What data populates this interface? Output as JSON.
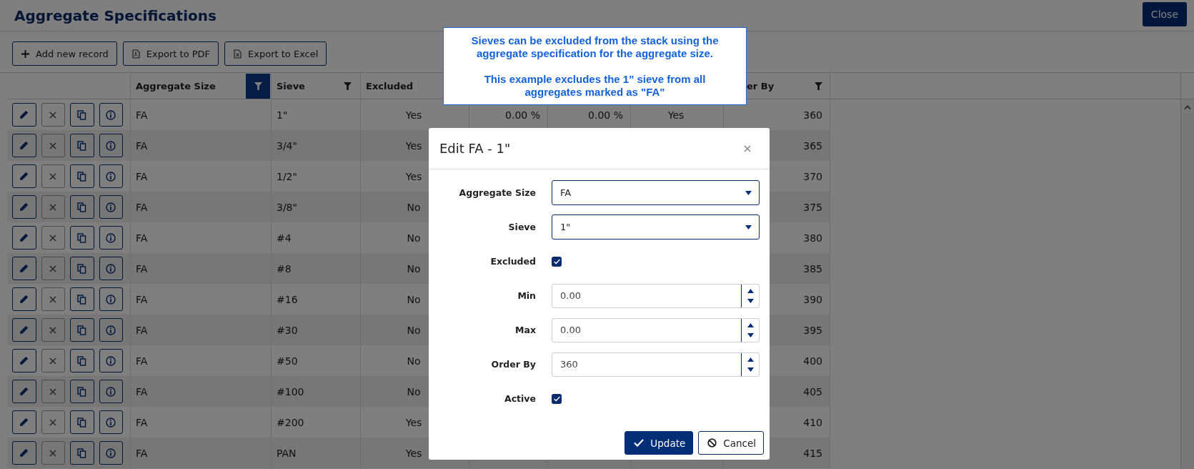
{
  "page": {
    "title": "Aggregate Specifications",
    "close_button": "Close"
  },
  "toolbar": [
    {
      "kind": "add",
      "label": "Add new record"
    },
    {
      "kind": "pdf",
      "label": "Export to PDF"
    },
    {
      "kind": "excel",
      "label": "Export to Excel"
    }
  ],
  "table": {
    "columns": [
      {
        "label": "Aggregate Size",
        "filtered": true
      },
      {
        "label": "Sieve",
        "filtered": false
      },
      {
        "label": "Excluded"
      },
      {
        "label": "er By",
        "filtered": false
      }
    ],
    "rows": [
      {
        "aggregate_size": "FA",
        "sieve": "1\"",
        "excluded": "Yes",
        "min": "0.00 %",
        "max": "0.00 %",
        "active": "Yes",
        "order_by": "360"
      },
      {
        "aggregate_size": "FA",
        "sieve": "3/4\"",
        "excluded": "Yes",
        "order_by": "365"
      },
      {
        "aggregate_size": "FA",
        "sieve": "1/2\"",
        "excluded": "Yes",
        "order_by": "370"
      },
      {
        "aggregate_size": "FA",
        "sieve": "3/8\"",
        "excluded": "No",
        "order_by": "375"
      },
      {
        "aggregate_size": "FA",
        "sieve": "#4",
        "excluded": "No",
        "order_by": "380"
      },
      {
        "aggregate_size": "FA",
        "sieve": "#8",
        "excluded": "No",
        "order_by": "385"
      },
      {
        "aggregate_size": "FA",
        "sieve": "#16",
        "excluded": "No",
        "order_by": "390"
      },
      {
        "aggregate_size": "FA",
        "sieve": "#30",
        "excluded": "No",
        "order_by": "395"
      },
      {
        "aggregate_size": "FA",
        "sieve": "#50",
        "excluded": "No",
        "order_by": "400"
      },
      {
        "aggregate_size": "FA",
        "sieve": "#100",
        "excluded": "No",
        "order_by": "405"
      },
      {
        "aggregate_size": "FA",
        "sieve": "#200",
        "excluded": "Yes",
        "order_by": "410"
      },
      {
        "aggregate_size": "FA",
        "sieve": "PAN",
        "excluded": "Yes",
        "order_by": "415"
      }
    ]
  },
  "callout": {
    "paragraphs": [
      "Sieves can be excluded from the stack using the aggregate specification for the aggregate size.",
      "This example excludes the 1\" sieve from all aggregates marked as \"FA\""
    ]
  },
  "modal": {
    "title": "Edit FA - 1\"",
    "fields": [
      {
        "kind": "select",
        "label": "Aggregate Size",
        "value": "FA"
      },
      {
        "kind": "select",
        "label": "Sieve",
        "value": "1\""
      },
      {
        "kind": "checkbox",
        "label": "Excluded",
        "checked": true
      },
      {
        "kind": "number",
        "label": "Min",
        "value": "0.00"
      },
      {
        "kind": "number",
        "label": "Max",
        "value": "0.00"
      },
      {
        "kind": "number",
        "label": "Order By",
        "value": "360"
      },
      {
        "kind": "checkbox",
        "label": "Active",
        "checked": true
      }
    ],
    "buttons": [
      {
        "kind": "primary",
        "label": "Update"
      },
      {
        "kind": "secondary",
        "label": "Cancel"
      }
    ]
  }
}
